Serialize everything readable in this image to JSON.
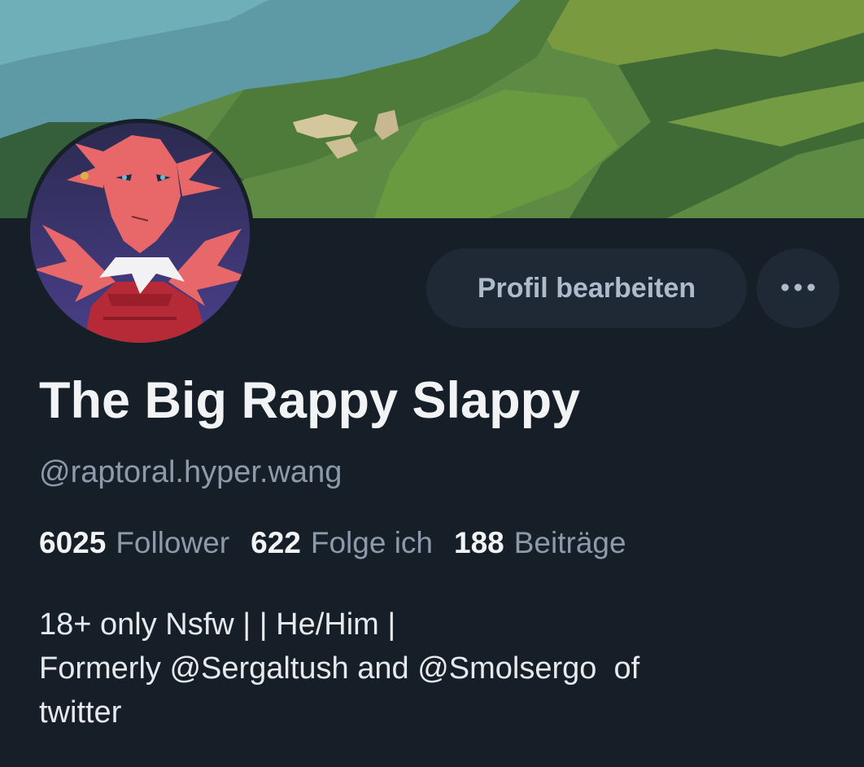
{
  "profile": {
    "display_name": "The Big Rappy Slappy",
    "handle": "@raptoral.hyper.wang",
    "edit_button_label": "Profil bearbeiten",
    "more_icon": "ellipsis-horizontal-icon",
    "stats": [
      {
        "value": "6025",
        "label": "Follower"
      },
      {
        "value": "622",
        "label": "Folge ich"
      },
      {
        "value": "188",
        "label": "Beiträge"
      }
    ],
    "bio": {
      "line1": "18+ only Nsfw | | He/Him |",
      "line2": "Formerly @Sergaltush and @Smolsergo  of",
      "line3": "twitter"
    }
  },
  "colors": {
    "background": "#161e27",
    "button_bg": "#1e2935",
    "button_text": "#aebbca",
    "primary_text": "#f1f3f5",
    "secondary_text": "#8d9aab"
  }
}
